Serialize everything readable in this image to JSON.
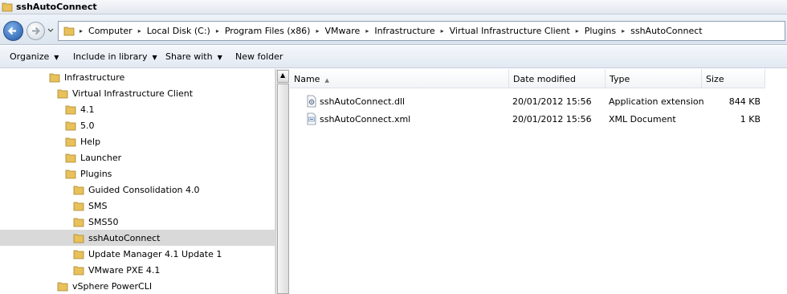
{
  "window": {
    "title": "sshAutoConnect"
  },
  "address": {
    "crumbs": [
      "Computer",
      "Local Disk (C:)",
      "Program Files (x86)",
      "VMware",
      "Infrastructure",
      "Virtual Infrastructure Client",
      "Plugins",
      "sshAutoConnect"
    ]
  },
  "toolbar": {
    "organize": "Organize",
    "include": "Include in library",
    "share": "Share with",
    "newfolder": "New folder"
  },
  "nav": {
    "items": [
      {
        "label": "Infrastructure",
        "level": 0
      },
      {
        "label": "Virtual Infrastructure Client",
        "level": 1
      },
      {
        "label": "4.1",
        "level": 2
      },
      {
        "label": "5.0",
        "level": 2
      },
      {
        "label": "Help",
        "level": 2
      },
      {
        "label": "Launcher",
        "level": 2
      },
      {
        "label": "Plugins",
        "level": 2
      },
      {
        "label": "Guided Consolidation 4.0",
        "level": 3
      },
      {
        "label": "SMS",
        "level": 3
      },
      {
        "label": "SMS50",
        "level": 3
      },
      {
        "label": "sshAutoConnect",
        "level": 3,
        "selected": true
      },
      {
        "label": "Update Manager 4.1 Update 1",
        "level": 3
      },
      {
        "label": "VMware PXE 4.1",
        "level": 3
      },
      {
        "label": "vSphere PowerCLI",
        "level": 1
      }
    ]
  },
  "files": {
    "columns": {
      "name": "Name",
      "date": "Date modified",
      "type": "Type",
      "size": "Size"
    },
    "rows": [
      {
        "name": "sshAutoConnect.dll",
        "date": "20/01/2012 15:56",
        "type": "Application extension",
        "size": "844 KB",
        "icon": "dll-file-icon"
      },
      {
        "name": "sshAutoConnect.xml",
        "date": "20/01/2012 15:56",
        "type": "XML Document",
        "size": "1 KB",
        "icon": "xml-file-icon"
      }
    ]
  },
  "colors": {
    "folder": "#e8c15a",
    "selection": "#d9d9d9",
    "back_button": "#1d57a8"
  }
}
